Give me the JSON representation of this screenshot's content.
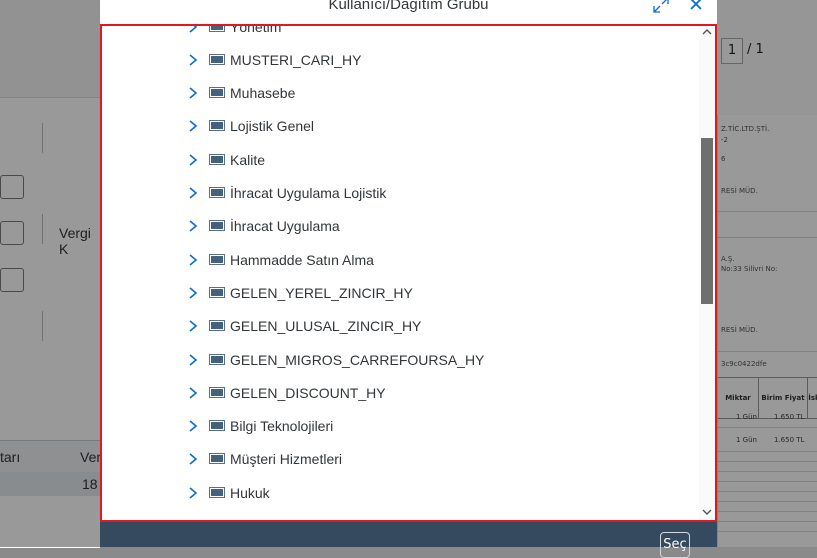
{
  "background": {
    "pager": {
      "current": "1",
      "total": "/ 1"
    },
    "vergi_label": "Vergi K",
    "table_header": "tarı",
    "table_header2": "Ver",
    "table_value": "18",
    "doc": {
      "line1": "Z.TİC.LTD.ŞTİ.",
      "line2": "-2",
      "line3": "6",
      "line4": "RESİ MÜD.",
      "line5": "A.Ş.",
      "line6": "No:33 Silivri  No:",
      "line7": "RESİ MÜD.",
      "line8": "3c9c0422dfe",
      "col_miktar": "Miktar",
      "col_birim": "Birim Fiyat",
      "col_isk": "İsk",
      "r1_qty": "1 Gün",
      "r1_price": "1.650 TL",
      "r2_qty": "1 Gün",
      "r2_price": "1.650 TL"
    }
  },
  "dialog": {
    "title": "Kullanıcı/Dağıtım Grubu",
    "expand_icon": "resize-icon",
    "close_icon": "close-icon",
    "items": [
      {
        "label": "Yönetim"
      },
      {
        "label": "MUSTERI_CARI_HY"
      },
      {
        "label": "Muhasebe"
      },
      {
        "label": "Lojistik Genel"
      },
      {
        "label": "Kalite"
      },
      {
        "label": "İhracat Uygulama Lojistik"
      },
      {
        "label": "İhracat Uygulama"
      },
      {
        "label": "Hammadde Satın Alma"
      },
      {
        "label": "GELEN_YEREL_ZINCIR_HY"
      },
      {
        "label": "GELEN_ULUSAL_ZINCIR_HY"
      },
      {
        "label": "GELEN_MIGROS_CARREFOURSA_HY"
      },
      {
        "label": "GELEN_DISCOUNT_HY"
      },
      {
        "label": "Bilgi Teknolojileri"
      },
      {
        "label": "Müşteri Hizmetleri"
      },
      {
        "label": "Hukuk"
      }
    ],
    "footer": {
      "select_button": "Seç"
    }
  },
  "colors": {
    "accent": "#0a6ed1",
    "highlight_border": "#e0191f",
    "footer": "#354a5f"
  }
}
